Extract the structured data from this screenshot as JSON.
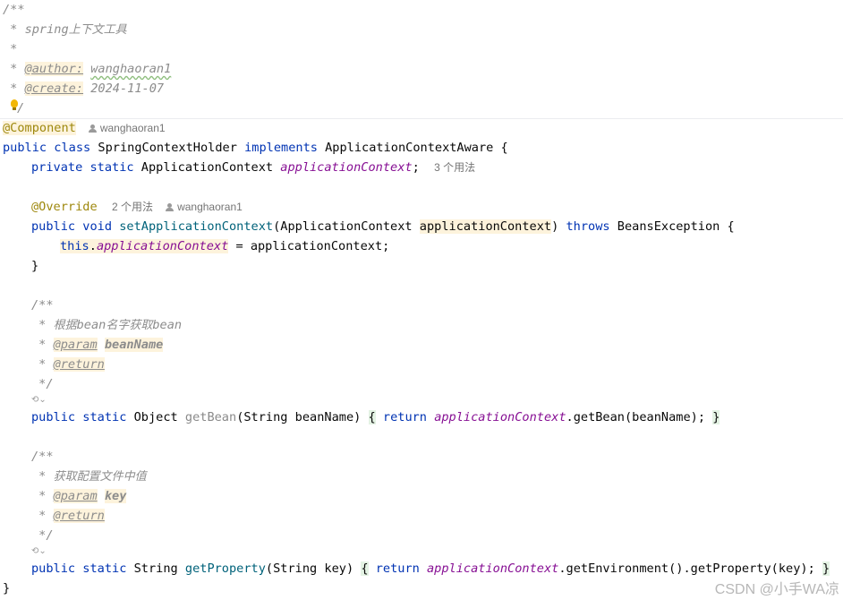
{
  "header_doc": {
    "open": "/**",
    "summary_prefix": " * ",
    "summary_latin": "spring",
    "summary_cjk": "上下文工具",
    "blank": " *",
    "star": " * ",
    "author_tag": "@author:",
    "author_value": "wanghaoran1",
    "create_tag": "@create:",
    "create_value": "2024-11-07",
    "close": "/"
  },
  "class_block": {
    "annotation": "@Component",
    "author_hint": "wanghaoran1",
    "decl_kw": "public class",
    "name": " SpringContextHolder ",
    "implements_kw": "implements",
    "iface": " ApplicationContextAware {",
    "field_kw": "private static",
    "field_type": " ApplicationContext ",
    "field_name": "applicationContext",
    "field_end": ";",
    "field_usages": "3 个用法"
  },
  "set_method": {
    "annotation": "@Override",
    "usages": "2 个用法",
    "author_hint": "wanghaoran1",
    "kw": "public void",
    "name": "setApplicationContext",
    "param_open": "(ApplicationContext ",
    "param_name": "applicationContext",
    "param_close": ") ",
    "throws_kw": "throws",
    "exc": " BeansException {",
    "this_kw": "this",
    "dot": ".",
    "field": "applicationContext",
    "assign": " = applicationContext;",
    "close": "}"
  },
  "getbean_doc": {
    "open": "/**",
    "star": " * ",
    "desc_1": "根据",
    "desc_2": "bean",
    "desc_3": "名字获取",
    "desc_4": "bean",
    "param_tag": "@param",
    "param_name": "beanName",
    "return_tag": "@return",
    "close": " */"
  },
  "getbean": {
    "kw": "public static",
    "type": " Object ",
    "name": "getBean",
    "params": "(String beanName) ",
    "lbrace": "{",
    "return_kw": "return",
    "field": "applicationContext",
    "call": ".getBean(beanName);",
    "rbrace": "}"
  },
  "getprop_doc": {
    "open": "/**",
    "star": " * ",
    "desc": "获取配置文件中值",
    "param_tag": "@param",
    "param_name": "key",
    "return_tag": "@return",
    "close": " */"
  },
  "getprop": {
    "kw": "public static",
    "type": " String ",
    "name": "getProperty",
    "params": "(String key) ",
    "lbrace": "{",
    "return_kw": "return",
    "field": "applicationContext",
    "call": ".getEnvironment().getProperty(key);",
    "rbrace": "}"
  },
  "class_close": "}",
  "gutter_icon_label": "⟲⌄",
  "watermark": "CSDN @小手WA凉"
}
